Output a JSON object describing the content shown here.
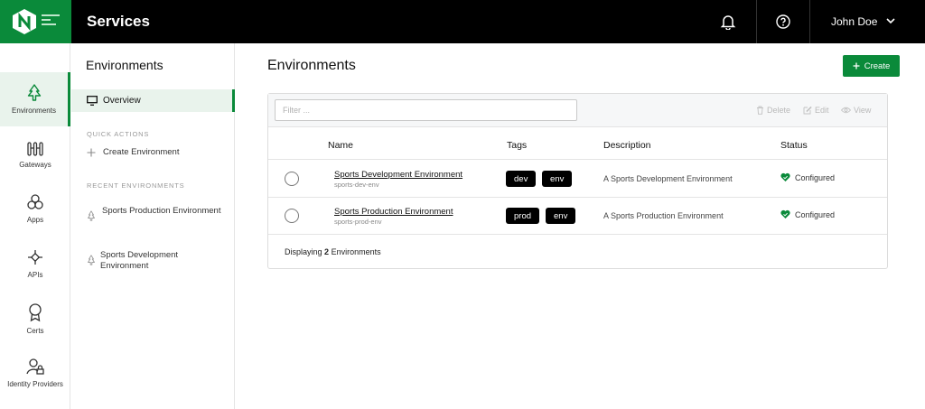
{
  "app": {
    "title": "Services",
    "user": "John Doe"
  },
  "rail": [
    {
      "label": "Environments",
      "icon": "trees-icon",
      "active": true
    },
    {
      "label": "Gateways",
      "icon": "gateway-icon"
    },
    {
      "label": "Apps",
      "icon": "apps-icon"
    },
    {
      "label": "APIs",
      "icon": "api-icon"
    },
    {
      "label": "Certs",
      "icon": "certificate-icon"
    },
    {
      "label": "Identity Providers",
      "icon": "identity-icon"
    }
  ],
  "subnav": {
    "title": "Environments",
    "overview": "Overview",
    "quick_actions_header": "QUICK ACTIONS",
    "create_environment": "Create Environment",
    "recent_header": "RECENT ENVIRONMENTS",
    "recent": [
      "Sports Production Environment",
      "Sports Development Environment"
    ]
  },
  "main": {
    "title": "Environments",
    "create_label": "Create",
    "filter_placeholder": "Filter ...",
    "actions": {
      "delete": "Delete",
      "edit": "Edit",
      "view": "View"
    },
    "columns": {
      "name": "Name",
      "tags": "Tags",
      "description": "Description",
      "status": "Status"
    },
    "rows": [
      {
        "name": "Sports Development Environment",
        "slug": "sports-dev-env",
        "tags": [
          "dev",
          "env"
        ],
        "description": "A Sports Development Environment",
        "status": "Configured"
      },
      {
        "name": "Sports Production Environment",
        "slug": "sports-prod-env",
        "tags": [
          "prod",
          "env"
        ],
        "description": "A Sports Production Environment",
        "status": "Configured"
      }
    ],
    "footer": {
      "prefix": "Displaying",
      "count": "2",
      "suffix": "Environments"
    }
  },
  "colors": {
    "brand": "#0a8a3a",
    "topbar": "#000000",
    "status_ok": "#0a8a3a"
  }
}
